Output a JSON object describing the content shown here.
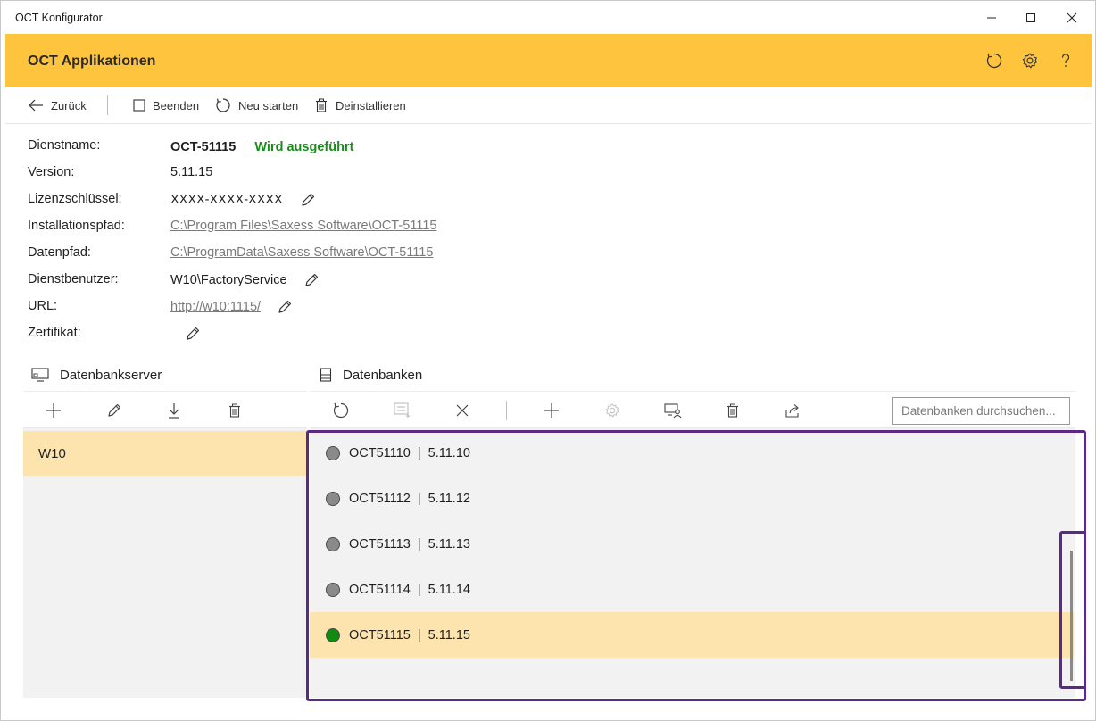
{
  "window": {
    "title": "OCT Konfigurator"
  },
  "header": {
    "title": "OCT Applikationen"
  },
  "toolbar": {
    "back_label": "Zurück",
    "stop_label": "Beenden",
    "restart_label": "Neu starten",
    "uninstall_label": "Deinstallieren"
  },
  "details": {
    "service_name_label": "Dienstname:",
    "service_name_value": "OCT-51115",
    "service_status": "Wird ausgeführt",
    "version_label": "Version:",
    "version_value": "5.11.15",
    "license_label": "Lizenzschlüssel:",
    "license_value": "XXXX-XXXX-XXXX",
    "install_path_label": "Installationspfad:",
    "install_path_value": "C:\\Program Files\\Saxess Software\\OCT-51115",
    "data_path_label": "Datenpfad:",
    "data_path_value": "C:\\ProgramData\\Saxess Software\\OCT-51115",
    "service_user_label": "Dienstbenutzer:",
    "service_user_value": "W10\\FactoryService",
    "url_label": "URL:",
    "url_value": "http://w10:1115/",
    "certificate_label": "Zertifikat:"
  },
  "servers": {
    "heading": "Datenbankserver",
    "items": [
      "W10"
    ]
  },
  "databases": {
    "heading": "Datenbanken",
    "search_placeholder": "Datenbanken durchsuchen...",
    "items": [
      {
        "name": "OCT51110",
        "version": "5.11.10",
        "label": "OCT51110  |  5.11.10",
        "running": false
      },
      {
        "name": "OCT51112",
        "version": "5.11.12",
        "label": "OCT51112  |  5.11.12",
        "running": false
      },
      {
        "name": "OCT51113",
        "version": "5.11.13",
        "label": "OCT51113  |  5.11.13",
        "running": false
      },
      {
        "name": "OCT51114",
        "version": "5.11.14",
        "label": "OCT51114  |  5.11.14",
        "running": false
      },
      {
        "name": "OCT51115",
        "version": "5.11.15",
        "label": "OCT51115  |  5.11.15",
        "running": true
      }
    ]
  },
  "colors": {
    "accent": "#ffc43d",
    "selection": "#fde4ae",
    "running": "#108a10",
    "stopped": "#8a8a8a",
    "status_text": "#1c8a1c",
    "highlight_outline": "#5b2a86"
  }
}
